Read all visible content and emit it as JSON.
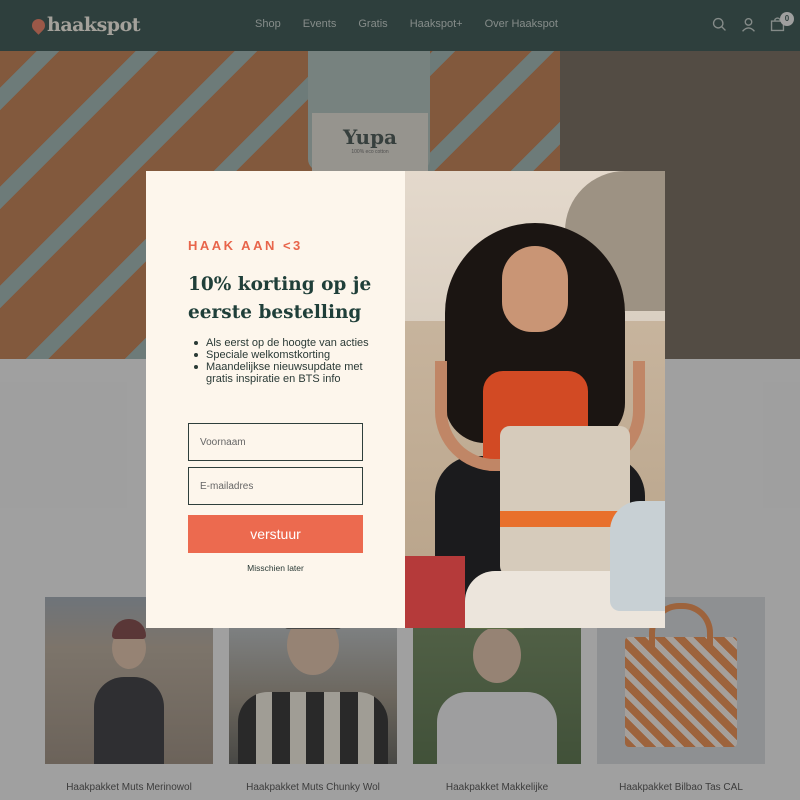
{
  "header": {
    "logo_text": "haakspot",
    "nav": [
      "Shop",
      "Events",
      "Gratis",
      "Haakspot+",
      "Over Haakspot"
    ],
    "cart_count": "0"
  },
  "hero": {
    "yarn_name": "Yupa",
    "yarn_sub": "100% eco cotton"
  },
  "modal": {
    "eyebrow": "HAAK AAN <3",
    "title": "10% korting op je eerste bestelling",
    "benefits": [
      "Als eerst op de hoogte van acties",
      "Speciale welkomstkorting",
      "Maandelijkse nieuwsupdate met gratis inspiratie en BTS info"
    ],
    "first_name_placeholder": "Voornaam",
    "email_placeholder": "E-mailadres",
    "submit_label": "verstuur",
    "later_label": "Misschien later"
  },
  "products": [
    {
      "title": "Haakpakket Muts Merinowol"
    },
    {
      "title": "Haakpakket Muts Chunky Wol"
    },
    {
      "title": "Haakpakket Makkelijke"
    },
    {
      "title": "Haakpakket Bilbao Tas CAL"
    }
  ],
  "colors": {
    "header_bg": "#1a3a35",
    "accent": "#ec6a4f",
    "modal_bg": "#fdf6ec",
    "title_green": "#1f3f39"
  }
}
